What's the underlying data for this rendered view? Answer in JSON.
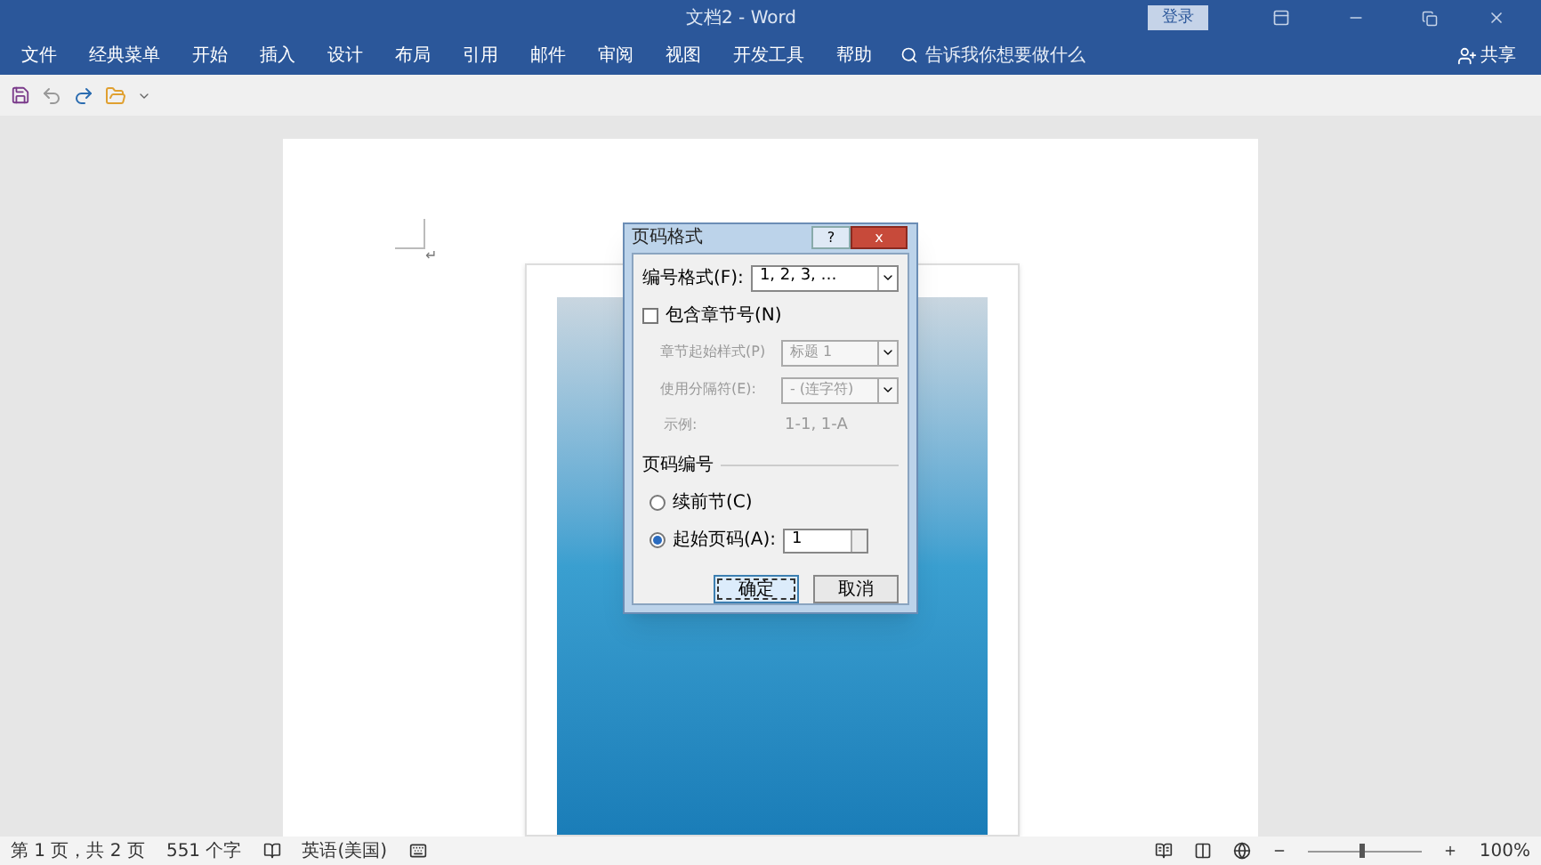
{
  "window": {
    "title": "文档2  -  Word",
    "login_button": "登录"
  },
  "ribbon_tabs": [
    {
      "label": "文件"
    },
    {
      "label": "经典菜单"
    },
    {
      "label": "开始"
    },
    {
      "label": "插入"
    },
    {
      "label": "设计"
    },
    {
      "label": "布局"
    },
    {
      "label": "引用"
    },
    {
      "label": "邮件"
    },
    {
      "label": "审阅"
    },
    {
      "label": "视图"
    },
    {
      "label": "开发工具"
    },
    {
      "label": "帮助"
    }
  ],
  "tell_me": {
    "placeholder": "告诉我你想要做什么"
  },
  "share_button": "共享",
  "document": {
    "paragraph_mark": "↵"
  },
  "dialog": {
    "title": "页码格式",
    "help_button": "?",
    "close_button": "x",
    "number_format": {
      "label": "编号格式(F):",
      "value": "1, 2, 3, …"
    },
    "include_chapter": {
      "label": "包含章节号(N)",
      "checked": false
    },
    "chapter_style": {
      "label": "章节起始样式(P)",
      "value": "标题 1",
      "disabled": true
    },
    "separator": {
      "label": "使用分隔符(E):",
      "value": "-  (连字符)",
      "disabled": true
    },
    "example": {
      "label": "示例:",
      "value": "1-1, 1-A",
      "disabled": true
    },
    "section_title": "页码编号",
    "radios": [
      {
        "label": "续前节(C)",
        "selected": false
      },
      {
        "label": "起始页码(A):",
        "selected": true
      }
    ],
    "start_value": "1",
    "buttons": [
      {
        "label": "确定",
        "default": true
      },
      {
        "label": "取消",
        "default": false
      }
    ]
  },
  "status_bar": {
    "page": "第 1 页，共 2 页",
    "words": "551 个字",
    "language": "英语(美国)",
    "zoom": {
      "level": 0.45,
      "reading": "100%"
    }
  }
}
